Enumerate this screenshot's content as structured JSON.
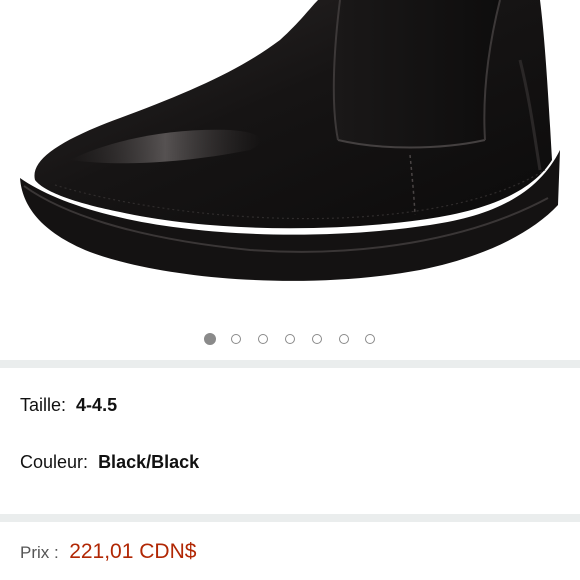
{
  "gallery": {
    "image_alt": "Black leather chelsea boot",
    "dot_count": 7,
    "active_index": 0
  },
  "details": {
    "size_label": "Taille:",
    "size_value": "4-4.5",
    "color_label": "Couleur:",
    "color_value": "Black/Black"
  },
  "price": {
    "label": "Prix :",
    "value": "221,01 CDN$",
    "color": "#b12704"
  },
  "colors": {
    "divider": "#eaeded",
    "boot": "#1c1a1a"
  }
}
